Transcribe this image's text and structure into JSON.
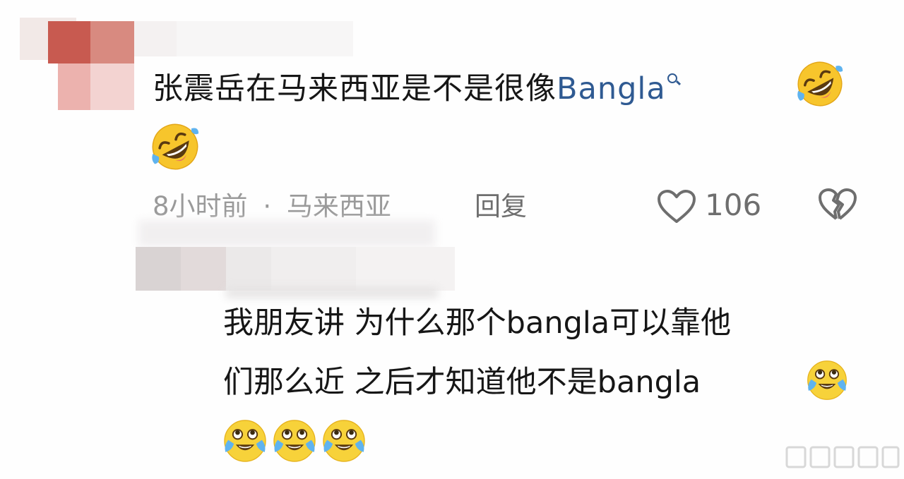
{
  "comment": {
    "text_prefix": "张震岳在马来西亚是不是很像",
    "link_text": "Bangla",
    "time": "8小时前",
    "separator": "·",
    "location": "马来西亚",
    "reply_label": "回复",
    "likes": "106"
  },
  "reply_comment": {
    "line1": "我朋友讲 为什么那个bangla可以靠他",
    "line2": "们那么近 之后才知道他不是bangla"
  },
  "icons": {
    "link_search": "search-icon",
    "emoji_laugh": "rolling-laughing-emoji",
    "emoji_crying": "crying-laughing-emoji",
    "like": "heart-outline-icon",
    "dislike": "broken-heart-icon"
  },
  "colors": {
    "link": "#2f5a92",
    "meta": "#9a9a9a",
    "text": "#161616"
  }
}
